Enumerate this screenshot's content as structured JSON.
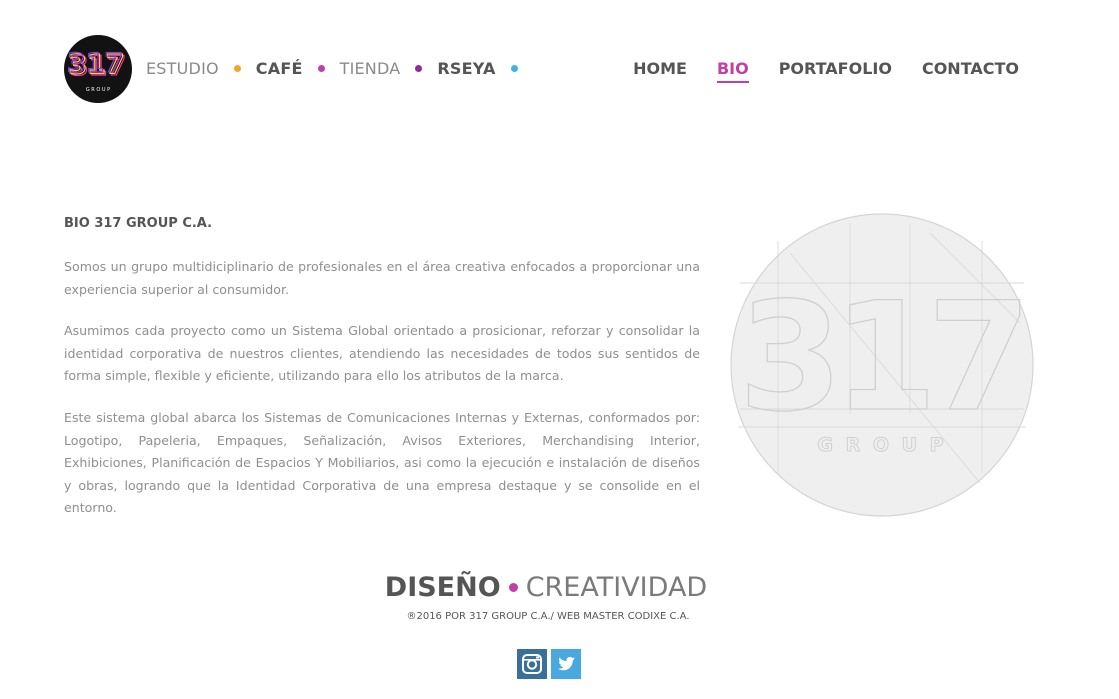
{
  "logo": {
    "title": "317",
    "subtitle": "G R O U P"
  },
  "subnav": [
    {
      "label": "ESTUDIO",
      "bold": false,
      "dot_color": "#f5a623"
    },
    {
      "label": "CAFÉ",
      "bold": true,
      "dot_color": "#c13fa7"
    },
    {
      "label": "TIENDA",
      "bold": false,
      "dot_color": "#8e2aa8"
    },
    {
      "label": "RSEYA",
      "bold": true,
      "dot_color": "#3fb0e8"
    }
  ],
  "mainnav": [
    {
      "label": "HOME",
      "active": false
    },
    {
      "label": "BIO",
      "active": true
    },
    {
      "label": "PORTAFOLIO",
      "active": false
    },
    {
      "label": "CONTACTO",
      "active": false
    }
  ],
  "content": {
    "heading": "BIO 317 GROUP C.A.",
    "paragraphs": [
      "Somos un grupo multidiciplinario de profesionales en el área creativa enfocados a proporcionar una experiencia superior al consumidor.",
      "Asumimos cada proyecto como un Sistema Global orientado a prosicionar, reforzar y consolidar la identidad corporativa de nuestros clientes, atendiendo las necesidades de todos sus sentidos de forma simple, flexible y eficiente, utilizando para ello los atributos de la marca.",
      "Este sistema global abarca los Sistemas de Comunicaciones Internas y Externas, conformados por: Logotipo, Papeleria, Empaques, Señalización, Avisos Exteriores, Merchandising Interior, Exhibiciones, Planificación de Espacios Y Mobiliarios, asi como la ejecución e instalación de diseños y obras, logrando que la Identidad Corporativa de una empresa destaque y se consolide en el entorno."
    ]
  },
  "emblem": {
    "title": "317",
    "subtitle": "G R O U P"
  },
  "footer": {
    "title_strong": "DISEÑO",
    "title_light": "CREATIVIDAD",
    "dot_color": "#c13fa7",
    "copyright": "®2016 POR 317 GROUP C.A./ WEB MASTER CODIXE C.A."
  },
  "social": [
    {
      "icon": "instagram-icon",
      "color": "#3a6f9a"
    },
    {
      "icon": "twitter-icon",
      "color": "#4aa8e0"
    }
  ],
  "colors": {
    "accent": "#c13fa7",
    "text_dark": "#555555",
    "text_body": "#8f8f8f"
  }
}
